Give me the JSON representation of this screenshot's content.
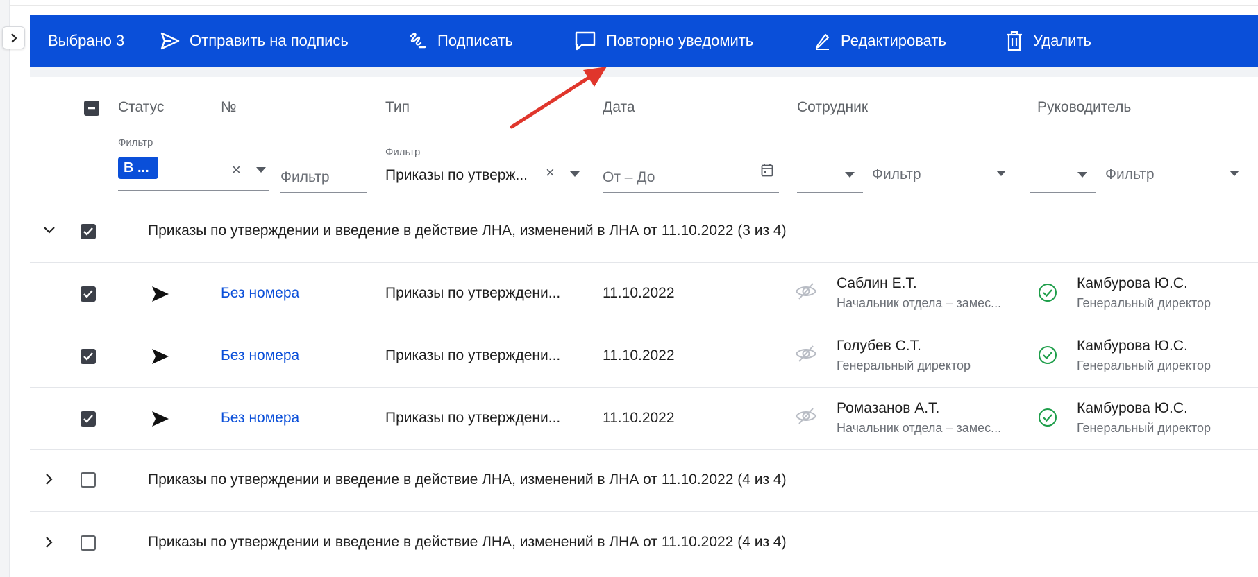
{
  "actionbar": {
    "selected": "Выбрано 3",
    "send": "Отправить на подпись",
    "sign": "Подписать",
    "renotify": "Повторно уведомить",
    "edit": "Редактировать",
    "delete": "Удалить",
    "bg_color": "#0a4fd9"
  },
  "columns": {
    "status": "Статус",
    "number": "№",
    "type": "Тип",
    "date": "Дата",
    "employee": "Сотрудник",
    "manager": "Руководитель"
  },
  "filters": {
    "status_label": "Фильтр",
    "status_chip": "В ...",
    "number_placeholder": "Фильтр",
    "type_label": "Фильтр",
    "type_value": "Приказы по утверж...",
    "date_placeholder": "От – До",
    "employee_placeholder": "Фильтр",
    "manager_placeholder": "Фильтр"
  },
  "groups": [
    {
      "title": "Приказы по утверждении и введение в действие ЛНА, изменений в ЛНА от 11.10.2022 (3 из 4)",
      "expanded": true,
      "checked": true
    },
    {
      "title": "Приказы по утверждении и введение в действие ЛНА, изменений в ЛНА от 11.10.2022 (4 из 4)",
      "expanded": false,
      "checked": false
    },
    {
      "title": "Приказы по утверждении и введение в действие ЛНА, изменений в ЛНА от 11.10.2022 (4 из 4)",
      "expanded": false,
      "checked": false
    }
  ],
  "rows": [
    {
      "number": "Без номера",
      "type": "Приказы по утверждени...",
      "date": "11.10.2022",
      "employee": "Саблин Е.Т.",
      "employee_role": "Начальник отдела – замес...",
      "manager": "Камбурова Ю.С.",
      "manager_role": "Генеральный директор"
    },
    {
      "number": "Без номера",
      "type": "Приказы по утверждени...",
      "date": "11.10.2022",
      "employee": "Голубев С.Т.",
      "employee_role": "Генеральный директор",
      "manager": "Камбурова Ю.С.",
      "manager_role": "Генеральный директор"
    },
    {
      "number": "Без номера",
      "type": "Приказы по утверждени...",
      "date": "11.10.2022",
      "employee": "Ромазанов А.Т.",
      "employee_role": "Начальник отдела – замес...",
      "manager": "Камбурова Ю.С.",
      "manager_role": "Генеральный директор"
    }
  ],
  "icons": {
    "send": "paper-plane-icon",
    "sign": "signature-icon",
    "renotify": "comment-icon",
    "edit": "pencil-icon",
    "delete": "trash-icon",
    "employee_status": "eye-off-icon",
    "manager_status": "check-circle-icon"
  },
  "accent_colors": {
    "link": "#0a4fd9",
    "success": "#1e9e4a",
    "annotation_arrow": "#e0362c"
  }
}
